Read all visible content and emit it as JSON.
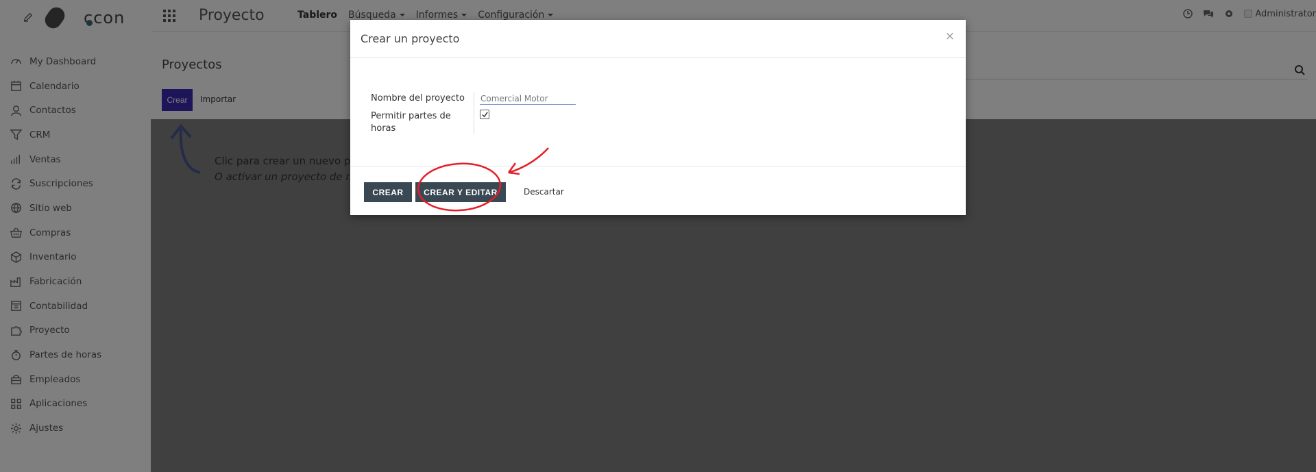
{
  "brand": {
    "logo_text": "ccon"
  },
  "sidebar": {
    "items": [
      {
        "label": "My Dashboard",
        "icon": "dashboard-icon"
      },
      {
        "label": "Calendario",
        "icon": "calendar-icon"
      },
      {
        "label": "Contactos",
        "icon": "user-icon"
      },
      {
        "label": "CRM",
        "icon": "filter-icon"
      },
      {
        "label": "Ventas",
        "icon": "chart-icon"
      },
      {
        "label": "Suscripciones",
        "icon": "refresh-icon"
      },
      {
        "label": "Sitio web",
        "icon": "globe-icon"
      },
      {
        "label": "Compras",
        "icon": "basket-icon"
      },
      {
        "label": "Inventario",
        "icon": "box-icon"
      },
      {
        "label": "Fabricación",
        "icon": "factory-icon"
      },
      {
        "label": "Contabilidad",
        "icon": "ledger-icon"
      },
      {
        "label": "Proyecto",
        "icon": "puzzle-icon"
      },
      {
        "label": "Partes de horas",
        "icon": "stopwatch-icon"
      },
      {
        "label": "Empleados",
        "icon": "people-icon"
      },
      {
        "label": "Aplicaciones",
        "icon": "grid-icon"
      },
      {
        "label": "Ajustes",
        "icon": "gear-icon"
      }
    ]
  },
  "topbar": {
    "app_title": "Proyecto",
    "nav": [
      {
        "label": "Tablero",
        "active": true
      },
      {
        "label": "Búsqueda",
        "dropdown": true
      },
      {
        "label": "Informes",
        "dropdown": true
      },
      {
        "label": "Configuración",
        "dropdown": true
      }
    ],
    "user": "Administrator"
  },
  "control": {
    "title": "Proyectos",
    "create_label": "Crear",
    "import_label": "Importar"
  },
  "help": {
    "line1": "Clic para crear un nuevo pr",
    "line2": "O activar un proyecto de m"
  },
  "modal": {
    "title": "Crear un proyecto",
    "close": "×",
    "fields": {
      "name_label": "Nombre del proyecto",
      "name_value": "Comercial Motor",
      "timesheets_label": "Permitir partes de horas",
      "timesheets_checked": true
    },
    "buttons": {
      "create": "CREAR",
      "create_edit": "CREAR Y EDITAR",
      "discard": "Descartar"
    }
  },
  "colors": {
    "primary": "#3c29b3",
    "dark_button": "#394852",
    "annotation": "#e41e26"
  }
}
